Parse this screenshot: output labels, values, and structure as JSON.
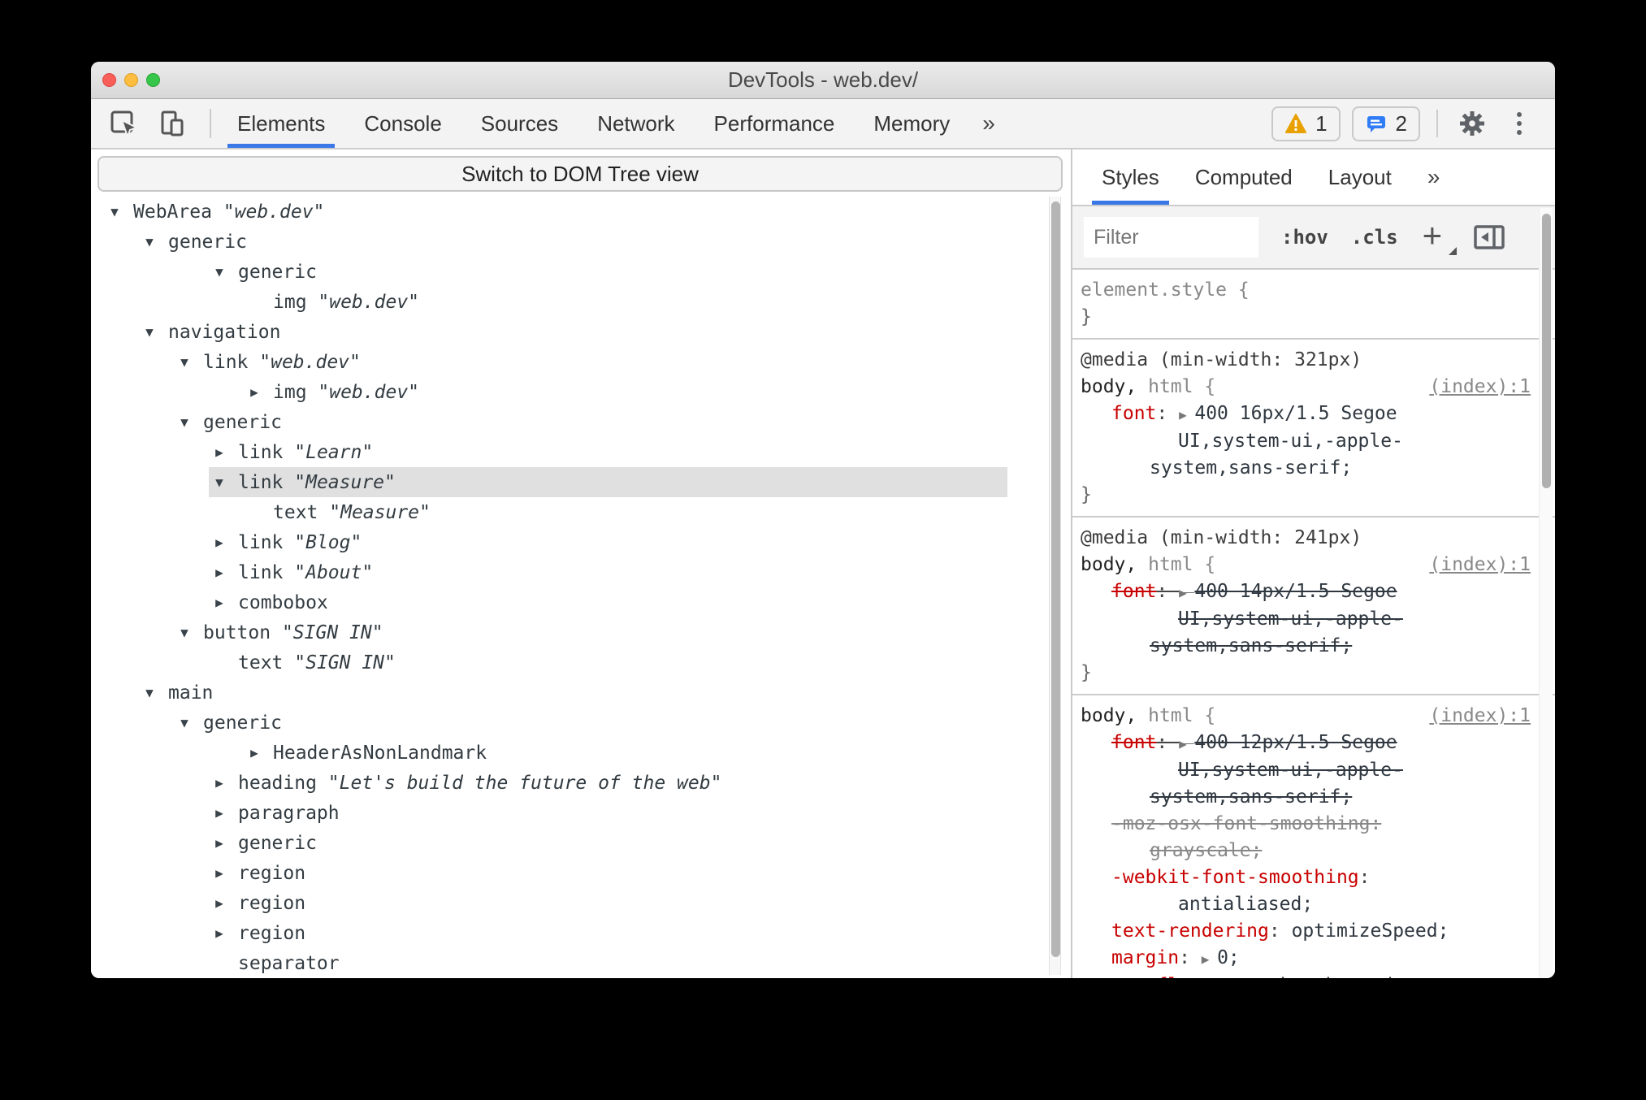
{
  "window": {
    "title": "DevTools - web.dev/"
  },
  "toolbar": {
    "tabs": [
      "Elements",
      "Console",
      "Sources",
      "Network",
      "Performance",
      "Memory"
    ],
    "active_tab": "Elements",
    "more_tabs_label": "»",
    "warning_count": "1",
    "message_count": "2"
  },
  "left_panel": {
    "switch_button_label": "Switch to DOM Tree view",
    "tree": [
      {
        "state": "open",
        "depth": 0,
        "role": "WebArea",
        "value": "\"web.dev\""
      },
      {
        "state": "open",
        "depth": 1,
        "role": "generic"
      },
      {
        "state": "open",
        "depth": 3,
        "role": "generic"
      },
      {
        "state": "leaf",
        "depth": 4,
        "role": "img",
        "value": "\"web.dev\""
      },
      {
        "state": "open",
        "depth": 1,
        "role": "navigation"
      },
      {
        "state": "open",
        "depth": 2,
        "role": "link",
        "value": "\"web.dev\""
      },
      {
        "state": "closed",
        "depth": 4,
        "role": "img",
        "value": "\"web.dev\""
      },
      {
        "state": "open",
        "depth": 2,
        "role": "generic"
      },
      {
        "state": "closed",
        "depth": 3,
        "role": "link",
        "value": "\"Learn\""
      },
      {
        "state": "open",
        "depth": 3,
        "role": "link",
        "value": "\"Measure\"",
        "selected": true
      },
      {
        "state": "leaf",
        "depth": 4,
        "role": "text",
        "value": "\"Measure\""
      },
      {
        "state": "closed",
        "depth": 3,
        "role": "link",
        "value": "\"Blog\""
      },
      {
        "state": "closed",
        "depth": 3,
        "role": "link",
        "value": "\"About\""
      },
      {
        "state": "closed",
        "depth": 3,
        "role": "combobox"
      },
      {
        "state": "open",
        "depth": 2,
        "role": "button",
        "value": "\"SIGN IN\""
      },
      {
        "state": "leaf",
        "depth": 3,
        "role": "text",
        "value": "\"SIGN IN\""
      },
      {
        "state": "open",
        "depth": 1,
        "role": "main"
      },
      {
        "state": "open",
        "depth": 2,
        "role": "generic"
      },
      {
        "state": "closed",
        "depth": 4,
        "role": "HeaderAsNonLandmark"
      },
      {
        "state": "closed",
        "depth": 3,
        "role": "heading",
        "value": "\"Let's build the future of the web\""
      },
      {
        "state": "closed",
        "depth": 3,
        "role": "paragraph"
      },
      {
        "state": "closed",
        "depth": 3,
        "role": "generic"
      },
      {
        "state": "closed",
        "depth": 3,
        "role": "region"
      },
      {
        "state": "closed",
        "depth": 3,
        "role": "region"
      },
      {
        "state": "closed",
        "depth": 3,
        "role": "region"
      },
      {
        "state": "leaf",
        "depth": 3,
        "role": "separator"
      }
    ]
  },
  "right_panel": {
    "tabs": [
      "Styles",
      "Computed",
      "Layout"
    ],
    "active_tab": "Styles",
    "more_tabs_label": "»",
    "filter_placeholder": "Filter",
    "hov_label": ":hov",
    "cls_label": ".cls",
    "add_label": "+",
    "sections": [
      {
        "lines": [
          {
            "seg": [
              [
                "element.style ",
                "gray"
              ],
              [
                "{",
                "gray"
              ]
            ]
          },
          {
            "seg": [
              [
                "}",
                "brace"
              ]
            ]
          }
        ]
      },
      {
        "lines": [
          {
            "seg": [
              [
                "@media (min-width: 321px)",
                "media"
              ]
            ]
          },
          {
            "seg": [
              [
                "body,",
                "sel-dark"
              ],
              [
                " html ",
                "sel-gray"
              ],
              [
                "{",
                "sel-gray"
              ]
            ],
            "link": "(index):1"
          },
          {
            "seg": [
              [
                "font",
                "prop"
              ],
              [
                ": ",
                "punct"
              ],
              [
                "▶ ",
                "arrow"
              ],
              [
                "400 16px/1.5 Segoe",
                "val"
              ]
            ],
            "indent": 1
          },
          {
            "seg": [
              [
                "UI,system-ui,-apple-",
                "val"
              ]
            ],
            "indent": 3
          },
          {
            "seg": [
              [
                "system,sans-serif;",
                "val"
              ]
            ],
            "indent": 2
          },
          {
            "seg": [
              [
                "}",
                "brace"
              ]
            ]
          }
        ]
      },
      {
        "lines": [
          {
            "seg": [
              [
                "@media (min-width: 241px)",
                "media"
              ]
            ]
          },
          {
            "seg": [
              [
                "body,",
                "sel-dark"
              ],
              [
                " html ",
                "sel-gray"
              ],
              [
                "{",
                "sel-gray"
              ]
            ],
            "link": "(index):1"
          },
          {
            "seg": [
              [
                "font",
                "prop"
              ],
              [
                ": ",
                "punct"
              ],
              [
                "▶ ",
                "arrow"
              ],
              [
                "400 14px/1.5 Segoe",
                "val"
              ]
            ],
            "indent": 1,
            "struck": true
          },
          {
            "seg": [
              [
                "UI,system-ui,-apple-",
                "val"
              ]
            ],
            "indent": 3,
            "struck": true
          },
          {
            "seg": [
              [
                "system,sans-serif;",
                "val"
              ]
            ],
            "indent": 2,
            "struck": true
          },
          {
            "seg": [
              [
                "}",
                "brace"
              ]
            ]
          }
        ]
      },
      {
        "lines": [
          {
            "seg": [
              [
                "body,",
                "sel-dark"
              ],
              [
                " html ",
                "sel-gray"
              ],
              [
                "{",
                "sel-gray"
              ]
            ],
            "link": "(index):1"
          },
          {
            "seg": [
              [
                "font",
                "prop"
              ],
              [
                ": ",
                "punct"
              ],
              [
                "▶ ",
                "arrow"
              ],
              [
                "400 12px/1.5 Segoe",
                "val"
              ]
            ],
            "indent": 1,
            "struck": true
          },
          {
            "seg": [
              [
                "UI,system-ui,-apple-",
                "val"
              ]
            ],
            "indent": 3,
            "struck": true
          },
          {
            "seg": [
              [
                "system,sans-serif;",
                "val"
              ]
            ],
            "indent": 2,
            "struck": true
          },
          {
            "seg": [
              [
                "-moz-osx-font-smoothing:",
                "gray"
              ]
            ],
            "indent": 1,
            "struck": true
          },
          {
            "seg": [
              [
                "grayscale;",
                "gray"
              ]
            ],
            "indent": 2,
            "struck": true
          },
          {
            "seg": [
              [
                "-webkit-font-smoothing",
                "prop"
              ],
              [
                ":",
                "punct"
              ]
            ],
            "indent": 1
          },
          {
            "seg": [
              [
                "antialiased;",
                "val"
              ]
            ],
            "indent": 3
          },
          {
            "seg": [
              [
                "text-rendering",
                "prop"
              ],
              [
                ": ",
                "punct"
              ],
              [
                "optimizeSpeed;",
                "val"
              ]
            ],
            "indent": 1
          },
          {
            "seg": [
              [
                "margin",
                "prop"
              ],
              [
                ": ",
                "punct"
              ],
              [
                "▶ ",
                "arrow"
              ],
              [
                "0;",
                "val"
              ]
            ],
            "indent": 1
          },
          {
            "seg": [
              [
                "overflow-wrap",
                "prop"
              ],
              [
                ": ",
                "punct"
              ],
              [
                "break-word;",
                "val"
              ]
            ],
            "indent": 1,
            "struck": true
          }
        ]
      }
    ]
  }
}
